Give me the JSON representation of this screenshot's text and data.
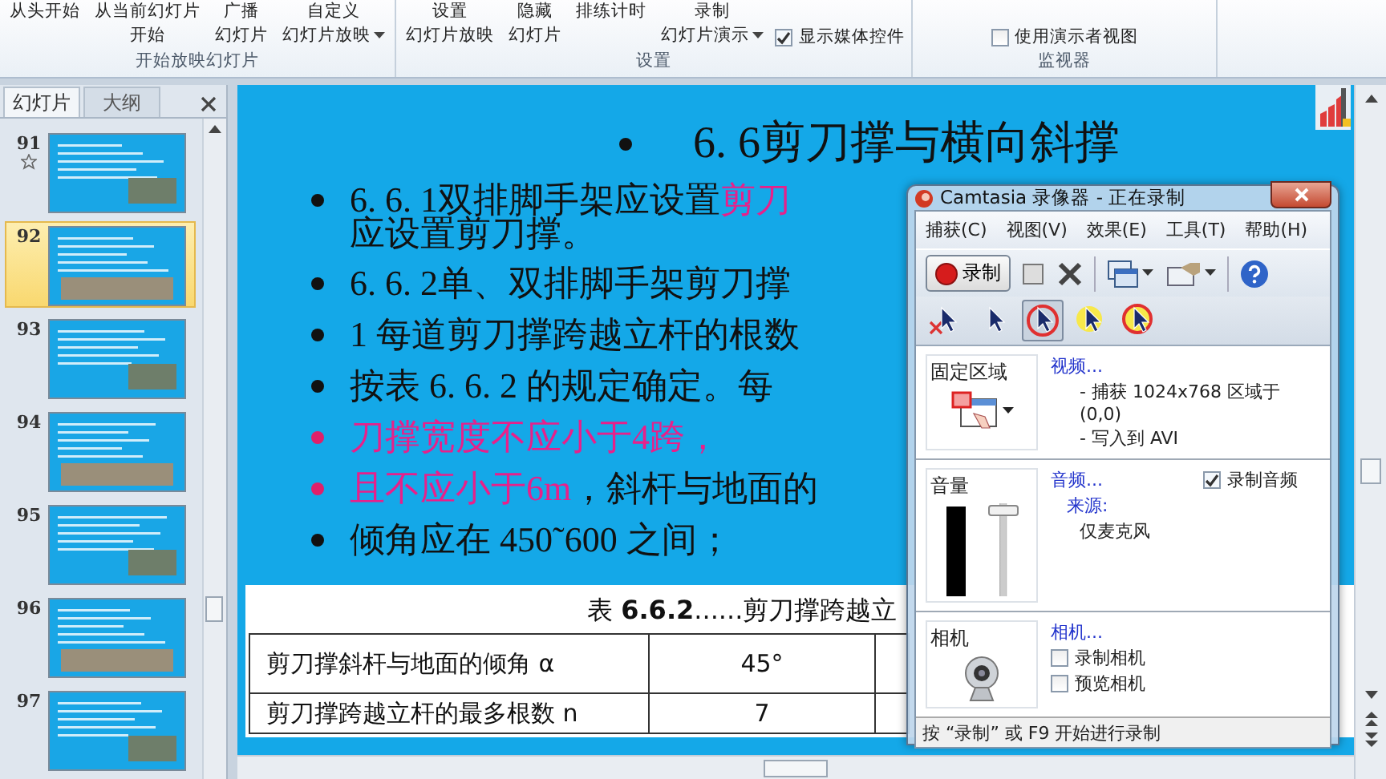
{
  "ribbon": {
    "groups": [
      {
        "label": "开始放映幻灯片",
        "items": [
          {
            "kind": "button",
            "lines": [
              "从头开始"
            ],
            "dropdown": false
          },
          {
            "kind": "button",
            "lines": [
              "从当前幻灯片",
              "开始"
            ],
            "dropdown": false
          },
          {
            "kind": "button",
            "lines": [
              "广播",
              "幻灯片"
            ],
            "dropdown": false
          },
          {
            "kind": "button",
            "lines": [
              "自定义",
              "幻灯片放映"
            ],
            "dropdown": true
          }
        ]
      },
      {
        "label": "设置",
        "items": [
          {
            "kind": "button",
            "lines": [
              "设置",
              "幻灯片放映"
            ],
            "dropdown": false
          },
          {
            "kind": "button",
            "lines": [
              "隐藏",
              "幻灯片"
            ],
            "dropdown": false
          },
          {
            "kind": "button",
            "lines": [
              "排练计时"
            ],
            "dropdown": false
          },
          {
            "kind": "button",
            "lines": [
              "录制",
              "幻灯片演示"
            ],
            "dropdown": true
          },
          {
            "kind": "checkbox",
            "label": "显示媒体控件",
            "checked": true
          }
        ]
      },
      {
        "label": "监视器",
        "items": [
          {
            "kind": "checkbox",
            "label": "使用演示者视图",
            "checked": false
          }
        ]
      }
    ]
  },
  "slides_panel": {
    "tabs": [
      {
        "label": "幻灯片",
        "selected": true
      },
      {
        "label": "大纲",
        "selected": false
      }
    ],
    "thumbnails": [
      {
        "number": "91",
        "selected": false,
        "animated": true
      },
      {
        "number": "92",
        "selected": true,
        "animated": false
      },
      {
        "number": "93",
        "selected": false,
        "animated": false
      },
      {
        "number": "94",
        "selected": false,
        "animated": false
      },
      {
        "number": "95",
        "selected": false,
        "animated": false
      },
      {
        "number": "96",
        "selected": false,
        "animated": false
      },
      {
        "number": "97",
        "selected": false,
        "animated": false
      }
    ]
  },
  "slide": {
    "title": "6. 6剪刀撑与横向斜撑",
    "lines": [
      {
        "bullet": true,
        "parts": [
          {
            "text": "6. 6. 1双排脚手架应设置",
            "highlight": false
          },
          {
            "text": "剪刀",
            "highlight": true
          }
        ]
      },
      {
        "bullet": false,
        "parts": [
          {
            "text": "应设置剪刀撑。",
            "highlight": false
          }
        ]
      },
      {
        "bullet": true,
        "parts": [
          {
            "text": "6. 6. 2单、双排脚手架剪刀撑",
            "highlight": false
          }
        ]
      },
      {
        "bullet": true,
        "parts": [
          {
            "text": "1 每道剪刀撑跨越立杆的根数",
            "highlight": false
          }
        ]
      },
      {
        "bullet": true,
        "parts": [
          {
            "text": "按表 6. 6. 2 的规定确定。每",
            "highlight": false
          }
        ]
      },
      {
        "bullet": true,
        "parts": [
          {
            "text": "刀撑宽度不应小于4跨，",
            "highlight": true
          }
        ]
      },
      {
        "bullet": true,
        "parts": [
          {
            "text": "且不应小于6m",
            "highlight": true
          },
          {
            "text": "，斜杆与地面的",
            "highlight": false
          }
        ]
      },
      {
        "bullet": true,
        "parts": [
          {
            "text": "倾角应在 450˜600 之间；",
            "highlight": false
          }
        ]
      }
    ],
    "table": {
      "caption": "表 **6.6.2**......剪刀撑跨越立",
      "rows": [
        [
          "剪刀撑斜杆与地面的倾角 α",
          "45°"
        ],
        [
          "剪刀撑跨越立杆的最多根数 n",
          "7"
        ]
      ]
    }
  },
  "recorder": {
    "title": "Camtasia 录像器 - 正在录制",
    "menu": [
      "捕获(C)",
      "视图(V)",
      "效果(E)",
      "工具(T)",
      "帮助(H)"
    ],
    "record_button": "录制",
    "cursor_tools": [
      {
        "kind": "hidden",
        "selected": false
      },
      {
        "kind": "plain",
        "selected": false
      },
      {
        "kind": "ring",
        "selected": true
      },
      {
        "kind": "halo",
        "selected": false
      },
      {
        "kind": "both",
        "selected": false
      }
    ],
    "region": {
      "heading": "固定区域",
      "link": "视频...",
      "lines": [
        "- 捕获 1024x768 区域于 (0,0)",
        "- 写入到 AVI"
      ]
    },
    "audio": {
      "heading": "音量",
      "link": "音频...",
      "source_link": "来源:",
      "source": "仅麦克风",
      "record_audio": {
        "label": "录制音频",
        "checked": true
      },
      "volume": {
        "level": 0.95
      }
    },
    "camera": {
      "heading": "相机",
      "link": "相机...",
      "options": [
        {
          "label": "录制相机",
          "checked": false
        },
        {
          "label": "预览相机",
          "checked": false
        }
      ]
    },
    "status": "按 “录制” 或 F9 开始进行录制"
  }
}
